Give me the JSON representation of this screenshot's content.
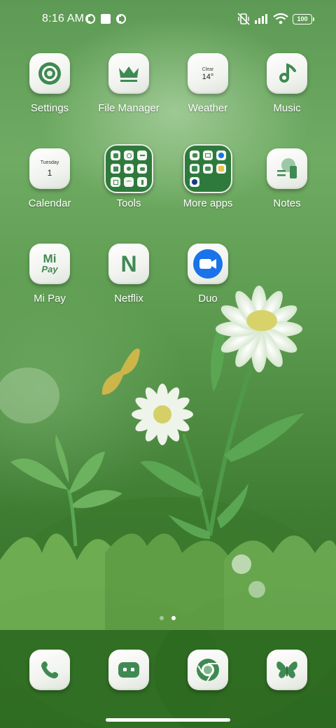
{
  "status_bar": {
    "time": "8:16 AM",
    "battery": "100",
    "icons": [
      "notification-app-icon",
      "notification-square-icon",
      "notification-app-icon",
      "vibrate-icon",
      "signal-icon",
      "wifi-icon",
      "battery-icon"
    ]
  },
  "apps": [
    {
      "label": "Settings",
      "icon": "settings-icon"
    },
    {
      "label": "File Manager",
      "icon": "crown-icon"
    },
    {
      "label": "Weather",
      "icon": "weather-icon",
      "tile_top": "Clear",
      "tile_value": "14°"
    },
    {
      "label": "Music",
      "icon": "music-note-icon"
    },
    {
      "label": "Calendar",
      "icon": "calendar-icon",
      "tile_top": "Tuesday",
      "tile_value": "1"
    },
    {
      "label": "Tools",
      "icon": "folder-icon"
    },
    {
      "label": "More apps",
      "icon": "folder-icon"
    },
    {
      "label": "Notes",
      "icon": "notes-icon"
    },
    {
      "label": "Mi Pay",
      "icon": "mi-pay-icon",
      "tile_top": "Mi",
      "tile_value": "Pay"
    },
    {
      "label": "Netflix",
      "icon": "netflix-icon",
      "tile_value": "N"
    },
    {
      "label": "Duo",
      "icon": "video-camera-icon"
    }
  ],
  "page_indicator": {
    "pages": 2,
    "current": 2
  },
  "dock": [
    {
      "name": "phone",
      "icon": "phone-icon"
    },
    {
      "name": "messages",
      "icon": "message-icon"
    },
    {
      "name": "chrome",
      "icon": "chrome-icon"
    },
    {
      "name": "themes",
      "icon": "butterfly-icon"
    }
  ],
  "colors": {
    "accent": "#3f8a52",
    "tile": "#f3f5f1",
    "duo_blue": "#1a73e8"
  }
}
